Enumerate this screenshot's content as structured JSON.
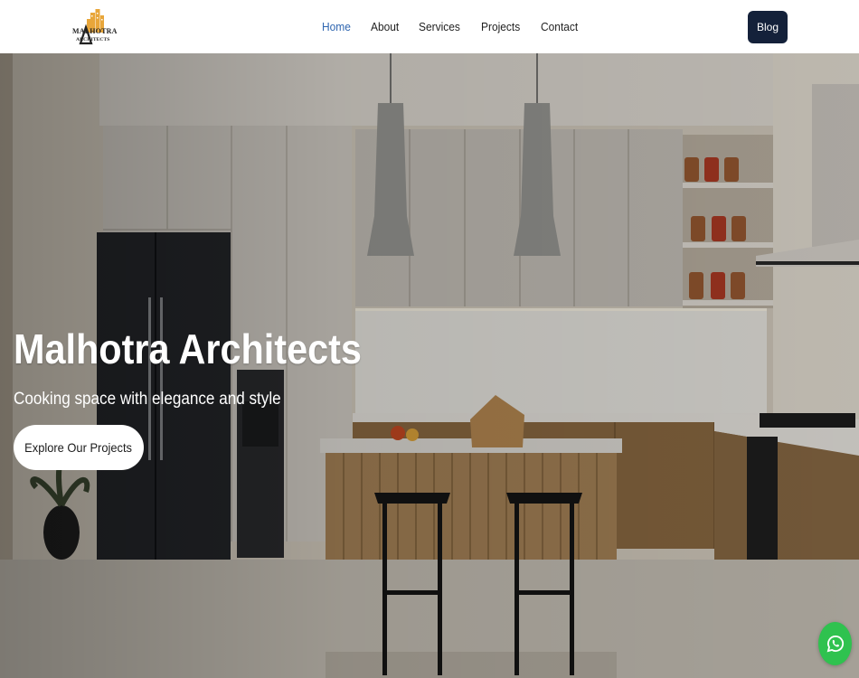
{
  "brand": {
    "logo_line1": "MALHOTRA",
    "logo_line2": "ARCHITECTS",
    "logo_icon": "building-logo-icon",
    "accent_color": "#e8a63a"
  },
  "nav": {
    "items": [
      {
        "label": "Home",
        "active": true
      },
      {
        "label": "About",
        "active": false
      },
      {
        "label": "Services",
        "active": false
      },
      {
        "label": "Projects",
        "active": false
      },
      {
        "label": "Contact",
        "active": false
      }
    ],
    "active_color": "#2f66b0",
    "blog_label": "Blog",
    "blog_color": "#14213a"
  },
  "hero": {
    "title": "Malhotra Architects",
    "subtitle": "Cooking space with elegance and style",
    "cta_label": "Explore Our Projects"
  },
  "floating": {
    "whatsapp_icon": "whatsapp-icon",
    "whatsapp_color": "#2fc24f"
  }
}
